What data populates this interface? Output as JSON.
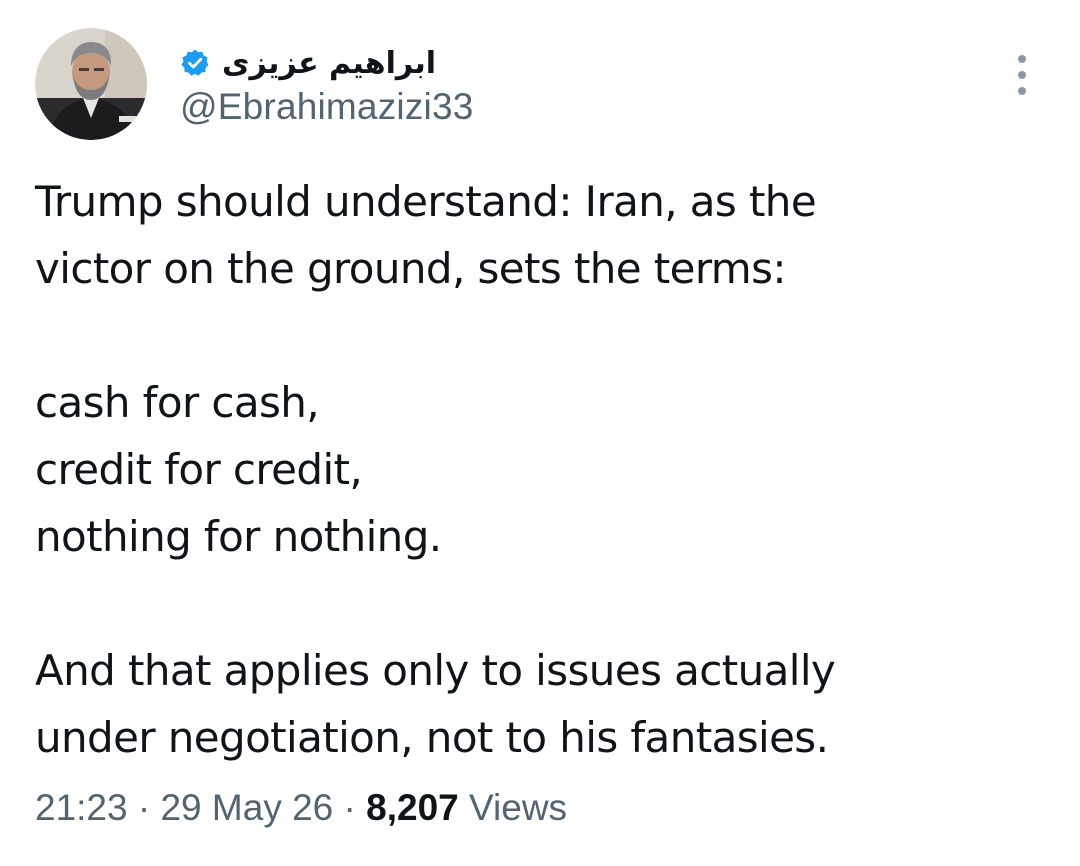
{
  "author": {
    "display_name": "ابراهیم عزیزی",
    "handle": "@Ebrahimazizi33",
    "verified_icon": "verified-badge-icon",
    "verified_color": "#1d9bf0",
    "avatar": "profile-photo"
  },
  "more_icon": "more-options-icon",
  "tweet": {
    "lines": [
      "Trump should understand: Iran, as the",
      "victor on the ground, sets the terms:",
      "",
      "cash for cash,",
      "credit for credit,",
      "nothing for nothing.",
      "",
      "And that applies only to issues actually",
      "under negotiation, not to his fantasies."
    ]
  },
  "meta": {
    "time": "21:23",
    "separator": "·",
    "date": "29 May 26",
    "views_count": "8,207",
    "views_label": "Views"
  }
}
